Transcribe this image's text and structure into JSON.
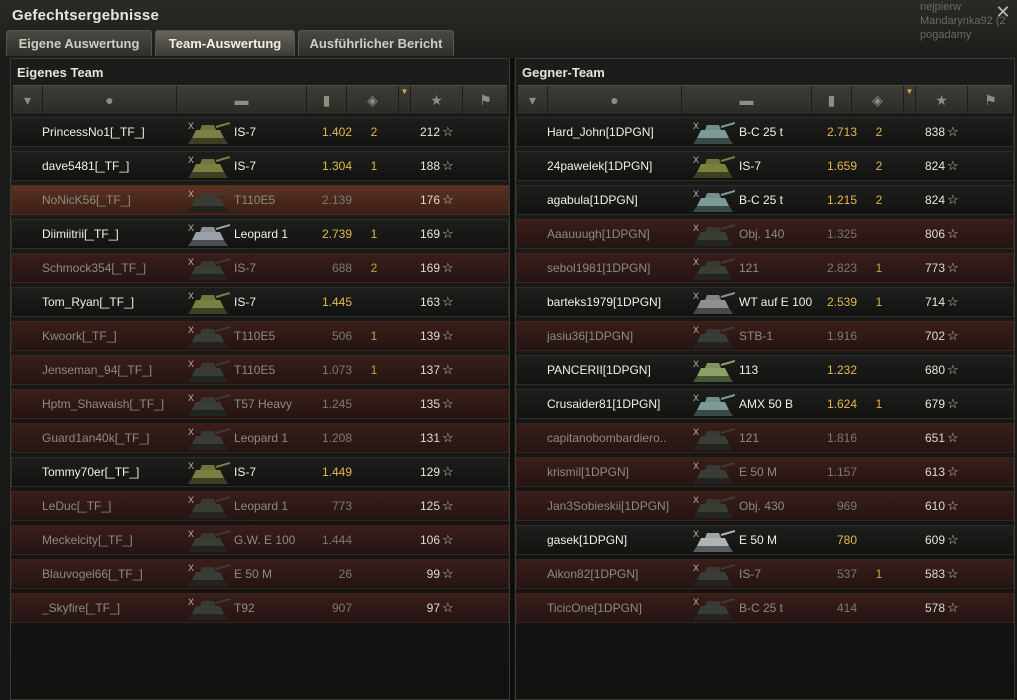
{
  "window": {
    "title": "Gefechtsergebnisse",
    "close_icon": "close-icon"
  },
  "chat": [
    "nejpierw",
    "Mandarynka92 (2",
    "pogadamy"
  ],
  "tabs": [
    {
      "label": "Eigene Auswertung",
      "active": false
    },
    {
      "label": "Team-Auswertung",
      "active": true
    },
    {
      "label": "Ausführlicher Bericht",
      "active": false
    }
  ],
  "colors": {
    "accent_gold": "#e6b751",
    "dead_row": "#3a1e1a",
    "alive_row": "#1e1e1c"
  },
  "headers": {
    "icons": [
      "rank-icon",
      "player-icon",
      "tank-icon",
      "damage-icon",
      "kills-icon",
      "sort-marker",
      "xp-star-icon",
      "medal-icon"
    ]
  },
  "own_team": {
    "title": "Eigenes Team",
    "rows": [
      {
        "name": "PrincessNo1[_TF_]",
        "tank": "IS-7",
        "damage": "1.402",
        "kills": "2",
        "xp": "212",
        "state": "alive",
        "tier": "X",
        "icon": "is7"
      },
      {
        "name": "dave5481[_TF_]",
        "tank": "IS-7",
        "damage": "1.304",
        "kills": "1",
        "xp": "188",
        "state": "alive",
        "tier": "X",
        "icon": "is7"
      },
      {
        "name": "NoNicK56[_TF_]",
        "tank": "T110E5",
        "damage": "2.139",
        "kills": "",
        "xp": "176",
        "state": "hl",
        "tier": "X",
        "icon": "dark"
      },
      {
        "name": "Diimiitrii[_TF_]",
        "tank": "Leopard 1",
        "damage": "2.739",
        "kills": "1",
        "xp": "169",
        "state": "alive",
        "tier": "X",
        "icon": "leo"
      },
      {
        "name": "Schmock354[_TF_]",
        "tank": "IS-7",
        "damage": "688",
        "kills": "2",
        "xp": "169",
        "state": "dead",
        "tier": "X",
        "icon": "dark"
      },
      {
        "name": "Tom_Ryan[_TF_]",
        "tank": "IS-7",
        "damage": "1.445",
        "kills": "",
        "xp": "163",
        "state": "alive",
        "tier": "X",
        "icon": "is7"
      },
      {
        "name": "Kwoork[_TF_]",
        "tank": "T110E5",
        "damage": "506",
        "kills": "1",
        "xp": "139",
        "state": "dead",
        "tier": "X",
        "icon": "dark"
      },
      {
        "name": "Jenseman_94[_TF_]",
        "tank": "T110E5",
        "damage": "1.073",
        "kills": "1",
        "xp": "137",
        "state": "dead",
        "tier": "X",
        "icon": "dark"
      },
      {
        "name": "Hptm_Shawaish[_TF_]",
        "tank": "T57 Heavy",
        "damage": "1.245",
        "kills": "",
        "xp": "135",
        "state": "dead",
        "tier": "X",
        "icon": "dark"
      },
      {
        "name": "Guard1an40k[_TF_]",
        "tank": "Leopard 1",
        "damage": "1.208",
        "kills": "",
        "xp": "131",
        "state": "dead",
        "tier": "X",
        "icon": "dark"
      },
      {
        "name": "Tommy70er[_TF_]",
        "tank": "IS-7",
        "damage": "1.449",
        "kills": "",
        "xp": "129",
        "state": "alive",
        "tier": "X",
        "icon": "is7"
      },
      {
        "name": "LeDuc[_TF_]",
        "tank": "Leopard 1",
        "damage": "773",
        "kills": "",
        "xp": "125",
        "state": "dead",
        "tier": "X",
        "icon": "dark"
      },
      {
        "name": "Meckelcity[_TF_]",
        "tank": "G.W. E 100",
        "damage": "1.444",
        "kills": "",
        "xp": "106",
        "state": "dead",
        "tier": "X",
        "icon": "dark"
      },
      {
        "name": "Blauvogel66[_TF_]",
        "tank": "E 50 M",
        "damage": "26",
        "kills": "",
        "xp": "99",
        "state": "dead",
        "tier": "X",
        "icon": "dark"
      },
      {
        "name": "_Skyfire[_TF_]",
        "tank": "T92",
        "damage": "907",
        "kills": "",
        "xp": "97",
        "state": "dead",
        "tier": "X",
        "icon": "dark"
      }
    ]
  },
  "enemy_team": {
    "title": "Gegner-Team",
    "rows": [
      {
        "name": "Hard_John[1DPGN]",
        "tank": "B-C 25 t",
        "damage": "2.713",
        "kills": "2",
        "xp": "838",
        "state": "alive",
        "tier": "X",
        "icon": "bc"
      },
      {
        "name": "24pawelek[1DPGN]",
        "tank": "IS-7",
        "damage": "1.659",
        "kills": "2",
        "xp": "824",
        "state": "alive",
        "tier": "X",
        "icon": "is7"
      },
      {
        "name": "agabula[1DPGN]",
        "tank": "B-C 25 t",
        "damage": "1.215",
        "kills": "2",
        "xp": "824",
        "state": "alive",
        "tier": "X",
        "icon": "bc"
      },
      {
        "name": "Aaauuugh[1DPGN]",
        "tank": "Obj. 140",
        "damage": "1.325",
        "kills": "",
        "xp": "806",
        "state": "dead",
        "tier": "X",
        "icon": "dark"
      },
      {
        "name": "sebol1981[1DPGN]",
        "tank": "121",
        "damage": "2.823",
        "kills": "1",
        "xp": "773",
        "state": "dead",
        "tier": "X",
        "icon": "dark"
      },
      {
        "name": "barteks1979[1DPGN]",
        "tank": "WT auf E 100",
        "damage": "2.539",
        "kills": "1",
        "xp": "714",
        "state": "alive",
        "tier": "X",
        "icon": "wt"
      },
      {
        "name": "jasiu36[1DPGN]",
        "tank": "STB-1",
        "damage": "1.916",
        "kills": "",
        "xp": "702",
        "state": "dead",
        "tier": "X",
        "icon": "dark"
      },
      {
        "name": "PANCERII[1DPGN]",
        "tank": "113",
        "damage": "1.232",
        "kills": "",
        "xp": "680",
        "state": "alive",
        "tier": "X",
        "icon": "t113"
      },
      {
        "name": "Crusaider81[1DPGN]",
        "tank": "AMX 50 B",
        "damage": "1.624",
        "kills": "1",
        "xp": "679",
        "state": "alive",
        "tier": "X",
        "icon": "bc"
      },
      {
        "name": "capitanobombardiero..",
        "tank": "121",
        "damage": "1.816",
        "kills": "",
        "xp": "651",
        "state": "dead",
        "tier": "X",
        "icon": "dark"
      },
      {
        "name": "krismil[1DPGN]",
        "tank": "E 50 M",
        "damage": "1.157",
        "kills": "",
        "xp": "613",
        "state": "dead",
        "tier": "X",
        "icon": "dark"
      },
      {
        "name": "Jan3Sobieskii[1DPGN]",
        "tank": "Obj. 430",
        "damage": "969",
        "kills": "",
        "xp": "610",
        "state": "dead",
        "tier": "X",
        "icon": "dark"
      },
      {
        "name": "gasek[1DPGN]",
        "tank": "E 50 M",
        "damage": "780",
        "kills": "",
        "xp": "609",
        "state": "alive",
        "tier": "X",
        "icon": "e50"
      },
      {
        "name": "Aikon82[1DPGN]",
        "tank": "IS-7",
        "damage": "537",
        "kills": "1",
        "xp": "583",
        "state": "dead",
        "tier": "X",
        "icon": "dark"
      },
      {
        "name": "TicicOne[1DPGN]",
        "tank": "B-C 25 t",
        "damage": "414",
        "kills": "",
        "xp": "578",
        "state": "dead",
        "tier": "X",
        "icon": "dark"
      }
    ]
  }
}
